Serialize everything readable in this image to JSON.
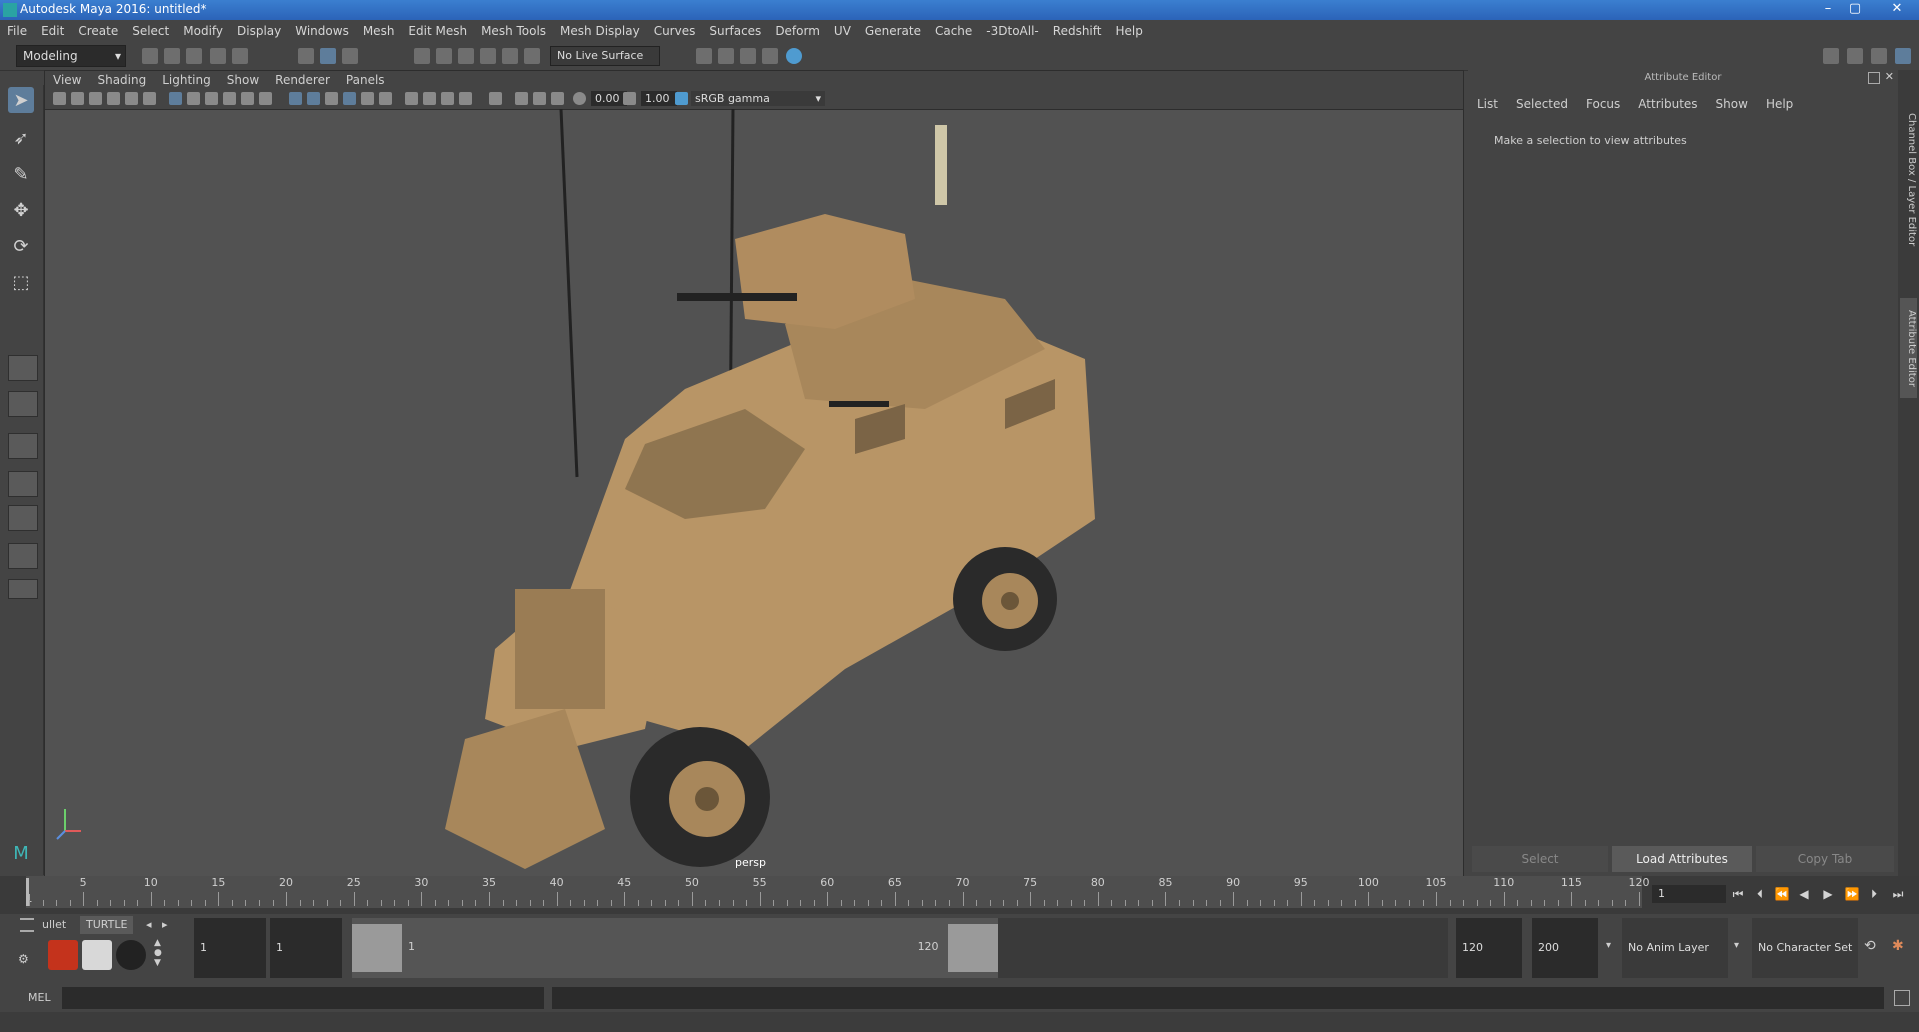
{
  "window": {
    "title": "Autodesk Maya 2016: untitled*"
  },
  "menubar": {
    "items": [
      "File",
      "Edit",
      "Create",
      "Select",
      "Modify",
      "Display",
      "Windows",
      "Mesh",
      "Edit Mesh",
      "Mesh Tools",
      "Mesh Display",
      "Curves",
      "Surfaces",
      "Deform",
      "UV",
      "Generate",
      "Cache",
      "-3DtoAll-",
      "Redshift",
      "Help"
    ]
  },
  "statusline": {
    "menuset": "Modeling",
    "live_surface": "No Live Surface"
  },
  "viewport": {
    "menu": [
      "View",
      "Shading",
      "Lighting",
      "Show",
      "Renderer",
      "Panels"
    ],
    "exposure": "0.00",
    "gamma": "1.00",
    "color_space": "sRGB gamma",
    "camera_label": "persp"
  },
  "attribute_editor": {
    "title": "Attribute Editor",
    "menu": [
      "List",
      "Selected",
      "Focus",
      "Attributes",
      "Show",
      "Help"
    ],
    "message": "Make a selection to view attributes",
    "buttons": {
      "select": "Select",
      "load": "Load Attributes",
      "copy": "Copy Tab"
    }
  },
  "side_tabs": {
    "channel_box": "Channel Box / Layer Editor",
    "attribute_editor": "Attribute Editor"
  },
  "timeline": {
    "ticks": [
      "5",
      "10",
      "15",
      "20",
      "25",
      "30",
      "35",
      "40",
      "45",
      "50",
      "55",
      "60",
      "65",
      "70",
      "75",
      "80",
      "85",
      "90",
      "95",
      "100",
      "105",
      "110",
      "115",
      "120"
    ],
    "start_label": "1",
    "current_frame": "1"
  },
  "range": {
    "shelf_tabs": [
      "ullet",
      "TURTLE"
    ],
    "start": "1",
    "playback_start": "1",
    "range_start_label": "1",
    "range_end_label": "120",
    "playback_end": "120",
    "end": "200",
    "anim_layer": "No Anim Layer",
    "character_set": "No Character Set"
  },
  "command": {
    "label": "MEL"
  },
  "colors": {
    "accent": "#5e7d9b",
    "vehicle": "#b89566",
    "titlebar": "#2b63b8"
  }
}
